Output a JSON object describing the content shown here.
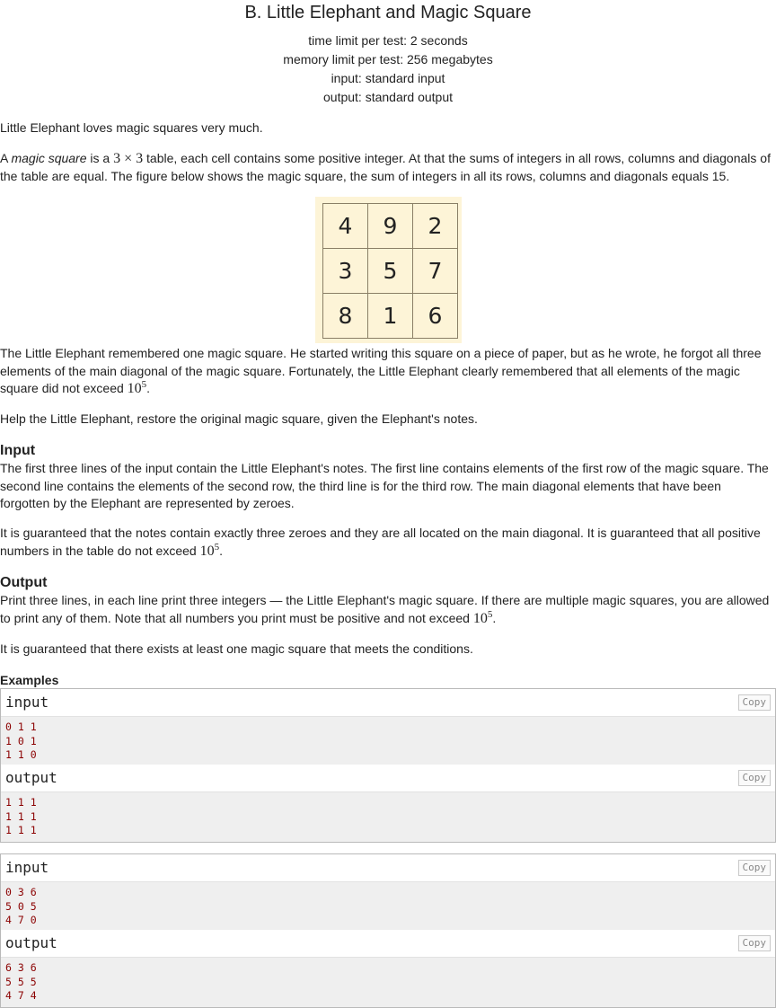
{
  "header": {
    "title": "B. Little Elephant and Magic Square",
    "time_limit": "time limit per test: 2 seconds",
    "memory_limit": "memory limit per test: 256 megabytes",
    "input": "input: standard input",
    "output": "output: standard output"
  },
  "statement": {
    "p1": "Little Elephant loves magic squares very much.",
    "p2_a": "A ",
    "p2_em": "magic square",
    "p2_b": " is a ",
    "p2_math": "3 × 3",
    "p2_c": " table, each cell contains some positive integer. At that the sums of integers in all rows, columns and diagonals of the table are equal. The figure below shows the magic square, the sum of integers in all its rows, columns and diagonals equals 15.",
    "p3_a": "The Little Elephant remembered one magic square. He started writing this square on a piece of paper, but as he wrote, he forgot all three elements of the main diagonal of the magic square. Fortunately, the Little Elephant clearly remembered that all elements of the magic square did not exceed ",
    "p3_base": "10",
    "p3_exp": "5",
    "p3_end": ".",
    "p4": "Help the Little Elephant, restore the original magic square, given the Elephant's notes."
  },
  "figure": {
    "cells": [
      "4",
      "9",
      "2",
      "3",
      "5",
      "7",
      "8",
      "1",
      "6"
    ]
  },
  "input_section": {
    "title": "Input",
    "p1": "The first three lines of the input contain the Little Elephant's notes. The first line contains elements of the first row of the magic square. The second line contains the elements of the second row, the third line is for the third row. The main diagonal elements that have been forgotten by the Elephant are represented by zeroes.",
    "p2_a": "It is guaranteed that the notes contain exactly three zeroes and they are all located on the main diagonal. It is guaranteed that all positive numbers in the table do not exceed ",
    "p2_base": "10",
    "p2_exp": "5",
    "p2_end": "."
  },
  "output_section": {
    "title": "Output",
    "p1_a": "Print three lines, in each line print three integers — the Little Elephant's magic square. If there are multiple magic squares, you are allowed to print any of them. Note that all numbers you print must be positive and not exceed ",
    "p1_base": "10",
    "p1_exp": "5",
    "p1_end": ".",
    "p2": "It is guaranteed that there exists at least one magic square that meets the conditions."
  },
  "examples": {
    "title": "Examples",
    "copy_label": "Copy",
    "input_label": "input",
    "output_label": "output",
    "ex1_input": [
      "0 1 1",
      "1 0 1",
      "1 1 0"
    ],
    "ex1_output": [
      "1 1 1",
      "1 1 1",
      "1 1 1"
    ],
    "ex2_input": [
      "0 3 6",
      "5 0 5",
      "4 7 0"
    ],
    "ex2_output": [
      "6 3 6",
      "5 5 5",
      "4 7 4"
    ]
  }
}
